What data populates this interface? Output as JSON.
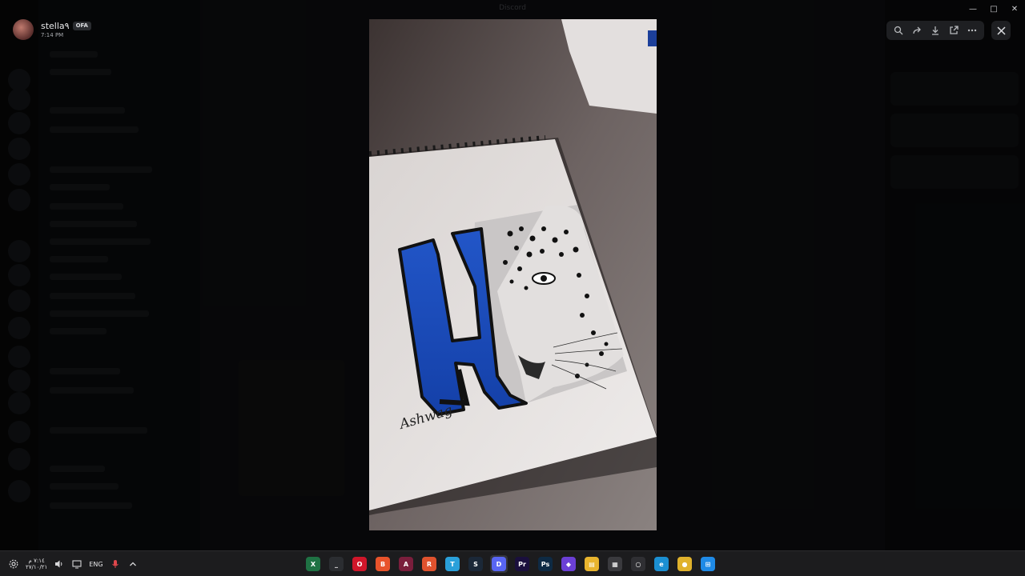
{
  "window": {
    "title": "Discord"
  },
  "user": {
    "name": "stella٩",
    "badge": "OFA",
    "time": "7:14 PM"
  },
  "photo": {
    "signature": "Ashwag"
  },
  "taskbar": {
    "clock_time": "٧:١٤ م",
    "clock_date": "٢٧/١٠/٢١",
    "language": "ENG",
    "apps": [
      {
        "icon": "excel-icon",
        "glyph": "X",
        "color": "#1f7244"
      },
      {
        "icon": "terminal-icon",
        "glyph": "_",
        "color": "#2b2d31"
      },
      {
        "icon": "opera-icon",
        "glyph": "O",
        "color": "#d0162a"
      },
      {
        "icon": "brave-icon",
        "glyph": "B",
        "color": "#e8532b"
      },
      {
        "icon": "affinity-icon",
        "glyph": "A",
        "color": "#7a1e3c"
      },
      {
        "icon": "app-icon",
        "glyph": "R",
        "color": "#e0522e"
      },
      {
        "icon": "telegram-icon",
        "glyph": "T",
        "color": "#2aa0da"
      },
      {
        "icon": "steam-icon",
        "glyph": "S",
        "color": "#1b2838"
      },
      {
        "icon": "discord-icon",
        "glyph": "D",
        "color": "#5865f2"
      },
      {
        "icon": "premiere-icon",
        "glyph": "Pr",
        "color": "#1a0f3d"
      },
      {
        "icon": "photoshop-icon",
        "glyph": "Ps",
        "color": "#0e2a44"
      },
      {
        "icon": "app-icon",
        "glyph": "◆",
        "color": "#6b3fd6"
      },
      {
        "icon": "file-explorer-icon",
        "glyph": "▤",
        "color": "#e8b42e"
      },
      {
        "icon": "store-icon",
        "glyph": "▦",
        "color": "#3a3a3e"
      },
      {
        "icon": "obs-icon",
        "glyph": "○",
        "color": "#2f2f33"
      },
      {
        "icon": "edge-icon",
        "glyph": "e",
        "color": "#1b8fd2"
      },
      {
        "icon": "chrome-icon",
        "glyph": "●",
        "color": "#e0b22c"
      },
      {
        "icon": "windows-icon",
        "glyph": "⊞",
        "color": "#1f8ae6"
      }
    ]
  }
}
